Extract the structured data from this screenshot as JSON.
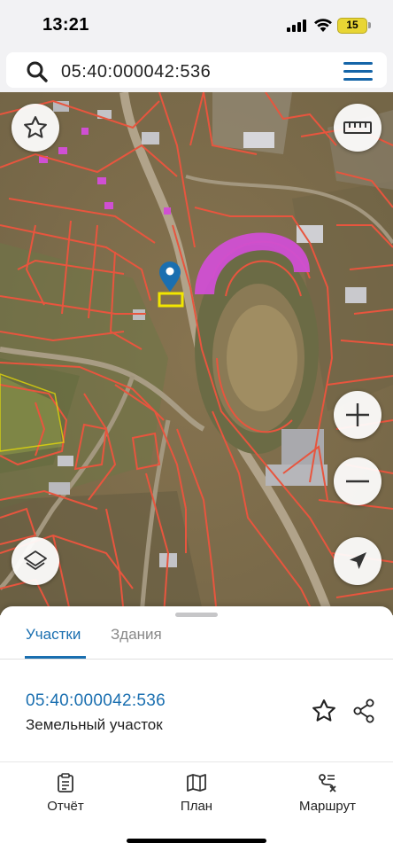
{
  "status_bar": {
    "time": "13:21",
    "battery": "15"
  },
  "search": {
    "query": "05:40:000042:536"
  },
  "map": {
    "buttons": [
      "favorite-star",
      "ruler",
      "zoom-in",
      "zoom-out",
      "layers",
      "locate"
    ],
    "selected_parcel_color": "#f2e600",
    "highlight_color": "#d04fd3",
    "boundary_color": "#e8553e",
    "marker_color": "#1a6fb0"
  },
  "sheet": {
    "tabs": [
      {
        "label": "Участки",
        "active": true
      },
      {
        "label": "Здания",
        "active": false
      }
    ],
    "result": {
      "number": "05:40:000042:536",
      "type": "Земельный участок"
    }
  },
  "nav": {
    "items": [
      {
        "label": "Отчёт",
        "icon": "report-icon"
      },
      {
        "label": "План",
        "icon": "map-plan-icon"
      },
      {
        "label": "Маршрут",
        "icon": "route-icon"
      }
    ]
  },
  "colors": {
    "accent": "#1a6fb0",
    "background": "#f2f2f4"
  }
}
